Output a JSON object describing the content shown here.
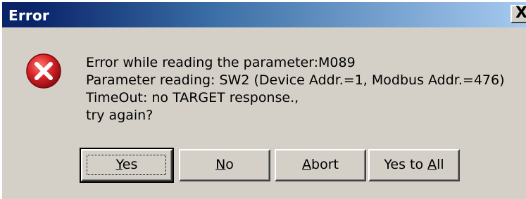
{
  "dialog": {
    "title": "Error",
    "close_label": "X",
    "icon": "error-icon",
    "message_lines": [
      "Error while reading the parameter:M089",
      "Parameter reading: SW2 (Device Addr.=1, Modbus Addr.=476)",
      "TimeOut: no TARGET response.,",
      "try again?"
    ],
    "buttons": {
      "yes": {
        "prefix": "",
        "mnemonic": "Y",
        "suffix": "es"
      },
      "no": {
        "prefix": "",
        "mnemonic": "N",
        "suffix": "o"
      },
      "abort": {
        "prefix": "",
        "mnemonic": "A",
        "suffix": "bort"
      },
      "yes_to_all": {
        "prefix": "Yes to ",
        "mnemonic": "A",
        "suffix": "ll"
      }
    }
  },
  "colors": {
    "titlebar_start": "#0a246a",
    "titlebar_end": "#a6caf0",
    "dialog_face": "#d4d0c8",
    "error_red": "#d8232a"
  }
}
